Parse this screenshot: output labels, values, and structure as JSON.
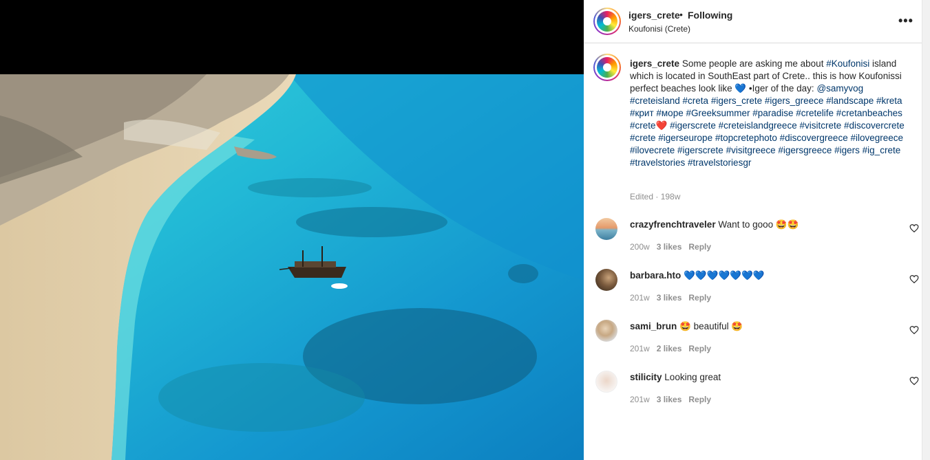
{
  "post": {
    "username": "igers_crete",
    "dot": "•",
    "following": "Following",
    "location": "Koufonisi (Crete)"
  },
  "caption": {
    "username": "igers_crete",
    "text1": " Some people are asking me about ",
    "tag_koufonisi": "#Koufonisi",
    "text2": " island which is located in SouthEast part of Crete.. this is how Koufonissi perfect beaches look like 💙 •Iger of the day: ",
    "mention": "@samyvog",
    "tags1": "#creteisland #creta #igers_crete #igers_greece #landscape #kreta #крит #море #Greeksummer #paradise #cretelife #cretanbeaches #crete",
    "heart": "❤️",
    "tags2": " #igerscrete #creteislandgreece #visitcrete #discovercrete #crete #igerseurope #topcretephoto #discovergreece #ilovegreece #ilovecrete #igerscrete #visitgreece #igersgreece #igers #ig_crete #travelstories #travelstoriesgr",
    "meta": "Edited · 198w"
  },
  "comments": [
    {
      "username": "crazyfrenchtraveler",
      "text": "Want to gooo 🤩🤩",
      "age": "200w",
      "likes": "3 likes",
      "reply": "Reply"
    },
    {
      "username": "barbara.hto",
      "text": "💙💙💙💙💙💙💙",
      "age": "201w",
      "likes": "3 likes",
      "reply": "Reply"
    },
    {
      "username": "sami_brun",
      "text": "🤩 beautiful 🤩",
      "age": "201w",
      "likes": "2 likes",
      "reply": "Reply"
    },
    {
      "username": "stilicity",
      "text": "Looking great",
      "age": "201w",
      "likes": "3 likes",
      "reply": "Reply"
    }
  ],
  "icons": {
    "more": "more-options-icon",
    "heart": "heart-outline-icon"
  },
  "colors": {
    "hashtag": "#00376b",
    "meta": "#8e8e8e",
    "text": "#262626"
  }
}
